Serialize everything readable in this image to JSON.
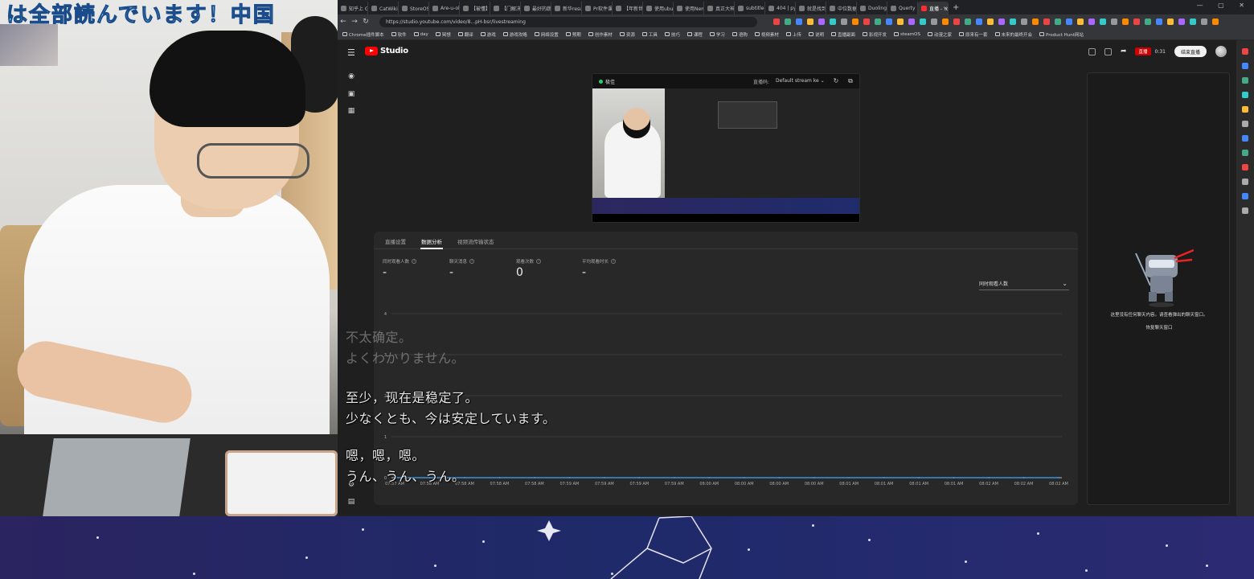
{
  "webcam": {
    "banner": "は全部読んでいます！中国"
  },
  "browser": {
    "tabs": [
      {
        "label": "知乎上 G",
        "active": false
      },
      {
        "label": "CatWiki 游",
        "active": false
      },
      {
        "label": "StoreOS小",
        "active": false
      },
      {
        "label": "Are-u-ok",
        "active": false
      },
      {
        "label": "【被懂】",
        "active": false
      },
      {
        "label": "【门解决】",
        "active": false
      },
      {
        "label": "最好的蔬",
        "active": false
      },
      {
        "label": "新华result",
        "active": false
      },
      {
        "label": "Pr软件课",
        "active": false
      },
      {
        "label": "【年新世】",
        "active": false
      },
      {
        "label": "使用ubu",
        "active": false
      },
      {
        "label": "使用Nem",
        "active": false
      },
      {
        "label": "真正大神",
        "active": false
      },
      {
        "label": "subtitle-ex",
        "active": false
      },
      {
        "label": "404 | pyt",
        "active": false
      },
      {
        "label": "就是找到",
        "active": false
      },
      {
        "label": "中位数据",
        "active": false
      },
      {
        "label": "Duolingo",
        "active": false
      },
      {
        "label": "Querty Le",
        "active": false
      },
      {
        "label": "直播 - You",
        "active": true
      }
    ],
    "url": "https://studio.youtube.com/video/8...pH-bsr/livestreaming",
    "bookmarks": [
      "Chrome插件脚本",
      "软件",
      "day",
      "冥想",
      "翻译",
      "游戏",
      "游戏攻略",
      "网络设置",
      "预期",
      "创作素材",
      "资源",
      "工具",
      "技巧",
      "课程",
      "学习",
      "语购",
      "视频素材",
      "上传",
      "说明",
      "直播副面",
      "影视开发",
      "steamOS",
      "动漫之家",
      "原来有一套",
      "未来的最终开会",
      "Product Hunt网站"
    ]
  },
  "studio": {
    "logo_text": "Studio",
    "live_badge": "直播",
    "live_time": "0:31",
    "end_button": "结束直播",
    "preview": {
      "status": "极佳",
      "key_label": "直播码:",
      "key_value": "Default stream ke"
    },
    "tabs": [
      "直播设置",
      "数据分析",
      "视频流传输状态"
    ],
    "active_tab": 1,
    "metrics": [
      {
        "label": "同时观看人数",
        "value": "-"
      },
      {
        "label": "聊天消息",
        "value": "-"
      },
      {
        "label": "观看次数",
        "value": "0"
      },
      {
        "label": "平均观看时长",
        "value": "-"
      }
    ],
    "dropdown": "同时观看人数",
    "chat": {
      "message": "这里没有任何聊天内容。请查看弹出的聊天窗口。",
      "link": "恢复聊天窗口"
    }
  },
  "chart_data": {
    "type": "line",
    "x": [
      "07:57 AM",
      "07:58 AM",
      "07:58 AM",
      "07:58 AM",
      "07:58 AM",
      "07:59 AM",
      "07:59 AM",
      "07:59 AM",
      "07:59 AM",
      "08:00 AM",
      "08:00 AM",
      "08:00 AM",
      "08:00 AM",
      "08:01 AM",
      "08:01 AM",
      "08:01 AM",
      "08:01 AM",
      "08:02 AM",
      "08:02 AM",
      "08:02 AM"
    ],
    "y_ticks": [
      "0",
      "1",
      "2",
      "3",
      "4"
    ],
    "ylim": [
      0,
      4
    ],
    "grid": true,
    "series": [
      {
        "values": [
          0,
          0,
          0,
          0,
          0,
          0,
          0,
          0,
          0,
          0,
          0,
          0,
          0,
          0,
          0,
          0,
          0,
          0,
          0,
          0
        ]
      }
    ]
  },
  "subtitles": [
    {
      "zh": "不太确定。",
      "ja": "よくわかりません。",
      "dim": true
    },
    {
      "zh": "至少，现在是稳定了。",
      "ja": "少なくとも、今は安定しています。",
      "dim": false
    },
    {
      "zh": "嗯，嗯，嗯。",
      "ja": "うん、うん、うん。",
      "dim": false
    }
  ],
  "colors": {
    "studio_bg": "#1f1f1f",
    "panel_bg": "#282828",
    "accent_red": "#ff0000",
    "starfield": "#1e2a6a"
  }
}
